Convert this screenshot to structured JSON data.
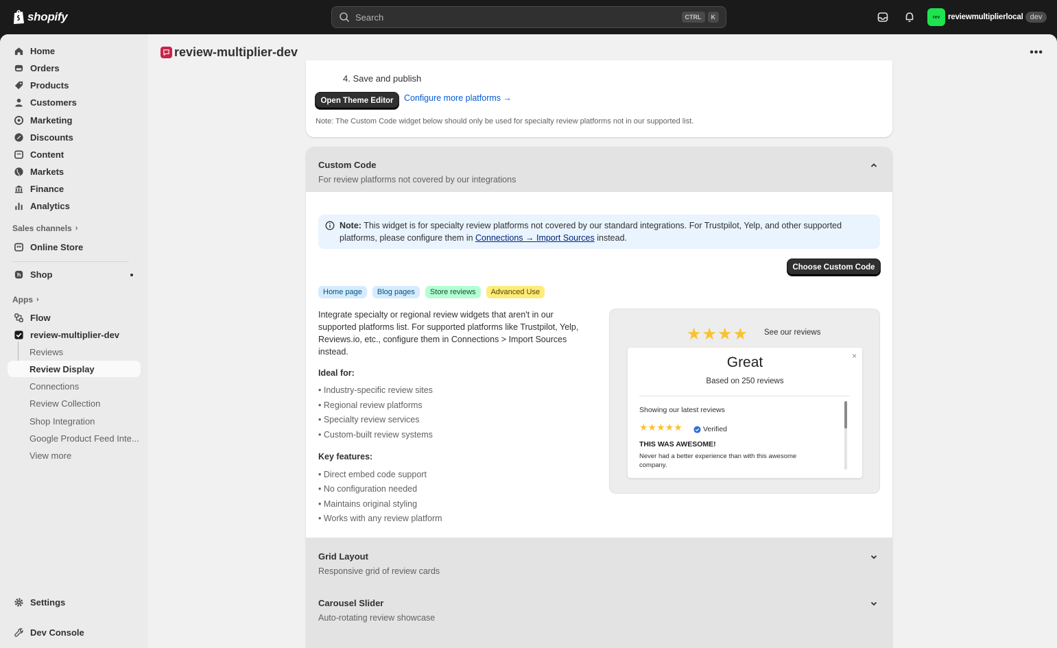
{
  "topbar": {
    "brand": "shopify",
    "search_placeholder": "Search",
    "shortcut_keys": [
      "CTRL",
      "K"
    ],
    "store_avatar": "rev",
    "store_name": "reviewmultiplierlocal",
    "store_badge": "dev"
  },
  "sidebar": {
    "main_items": [
      {
        "label": "Home",
        "icon": "home-icon"
      },
      {
        "label": "Orders",
        "icon": "orders-icon"
      },
      {
        "label": "Products",
        "icon": "tag-icon"
      },
      {
        "label": "Customers",
        "icon": "person-icon"
      },
      {
        "label": "Marketing",
        "icon": "target-icon"
      },
      {
        "label": "Discounts",
        "icon": "discount-icon"
      },
      {
        "label": "Content",
        "icon": "content-icon"
      },
      {
        "label": "Markets",
        "icon": "globe-icon"
      },
      {
        "label": "Finance",
        "icon": "bank-icon"
      },
      {
        "label": "Analytics",
        "icon": "chart-icon"
      }
    ],
    "sales_channels_label": "Sales channels",
    "online_store": "Online Store",
    "shop": "Shop",
    "apps_label": "Apps",
    "flow": "Flow",
    "app_name": "review-multiplier-dev",
    "app_sub_items": [
      "Reviews",
      "Review Display",
      "Connections",
      "Review Collection",
      "Shop Integration",
      "Google Product Feed Inte...",
      "View more"
    ],
    "settings": "Settings",
    "dev_console": "Dev Console"
  },
  "page": {
    "title": "review-multiplier-dev",
    "more": "•••"
  },
  "top_card": {
    "step4": "4. Save and publish",
    "open_theme_editor": "Open Theme Editor",
    "configure_link": "Configure more platforms →",
    "note": "Note: The Custom Code widget below should only be used for specialty review platforms not in our supported list."
  },
  "custom_code": {
    "title": "Custom Code",
    "subtitle": "For review platforms not covered by our integrations",
    "banner_note_label": "Note:",
    "banner_text_1": "This widget is for specialty review platforms not covered by our standard integrations. For Trustpilot, Yelp, and other supported platforms, please configure them in",
    "banner_link": "Connections → Import Sources",
    "banner_text_2": "instead.",
    "choose_button": "Choose Custom Code",
    "chips": [
      "Home page",
      "Blog pages",
      "Store reviews",
      "Advanced Use"
    ],
    "description": "Integrate specialty or regional review widgets that aren't in our supported platforms list. For supported platforms like Trustpilot, Yelp, Reviews.io, etc., configure them in Connections > Import Sources instead.",
    "ideal_label": "Ideal for:",
    "ideal_items": [
      "• Industry-specific review sites",
      "• Regional review platforms",
      "• Specialty review services",
      "• Custom-built review systems"
    ],
    "features_label": "Key features:",
    "feature_items": [
      "• Direct embed code support",
      "• No configuration needed",
      "• Maintains original styling",
      "• Works with any review platform"
    ],
    "preview": {
      "stars": "★★★★",
      "see_reviews": "See our reviews",
      "rating_word": "Great",
      "based_on": "Based on 250 reviews",
      "close": "×",
      "showing": "Showing our latest reviews",
      "review_stars": "★★★★★",
      "verified": "Verified",
      "review_title": "THIS WAS AWESOME!",
      "review_body": "Never had a better experience than with this awesome company."
    }
  },
  "grid_layout": {
    "title": "Grid Layout",
    "subtitle": "Responsive grid of review cards"
  },
  "carousel": {
    "title": "Carousel Slider",
    "subtitle": "Auto-rotating review showcase"
  },
  "colors": {
    "topbar": "#1a1a1a",
    "accent_link": "#005bd3",
    "star": "#f9c22e",
    "avatar": "#1ee34f",
    "app_icon": "#c8244a"
  }
}
